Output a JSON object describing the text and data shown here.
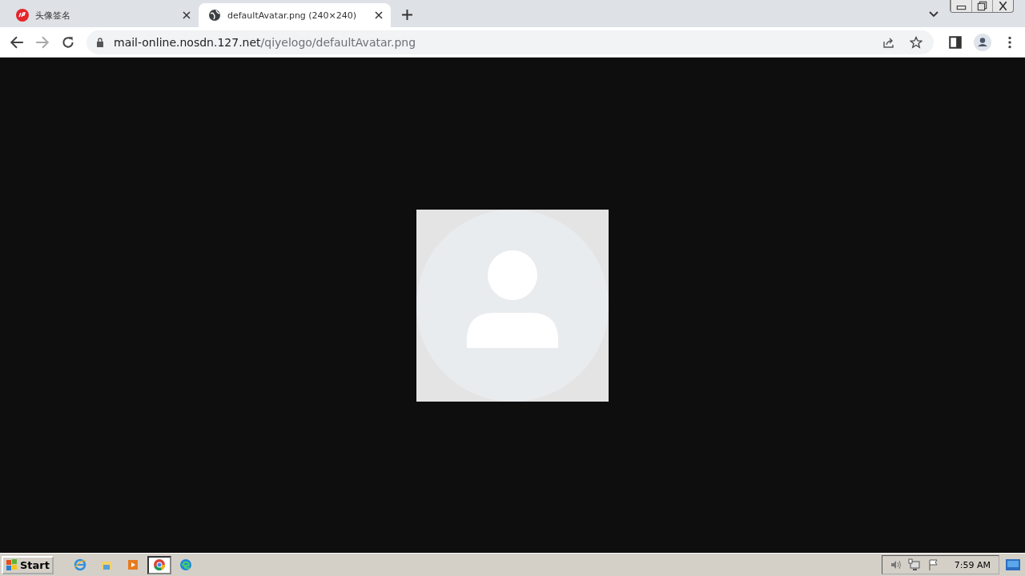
{
  "tabs": [
    {
      "title": "头像签名",
      "kind": "site",
      "selected": false
    },
    {
      "title": "defaultAvatar.png (240×240)",
      "kind": "globe",
      "selected": true
    }
  ],
  "address_bar": {
    "host": "mail-online.nosdn.127.net",
    "path": "/qiyelogo/defaultAvatar.png"
  },
  "viewer": {
    "image": {
      "kind": "avatar"
    }
  },
  "taskbar": {
    "start": "Start",
    "items": [
      {
        "kind": "ie",
        "selected": false
      },
      {
        "kind": "explorer",
        "selected": false
      },
      {
        "kind": "media",
        "selected": false
      },
      {
        "kind": "chrome",
        "selected": true
      },
      {
        "kind": "edge",
        "selected": false
      }
    ],
    "clock": "7:59 AM"
  }
}
